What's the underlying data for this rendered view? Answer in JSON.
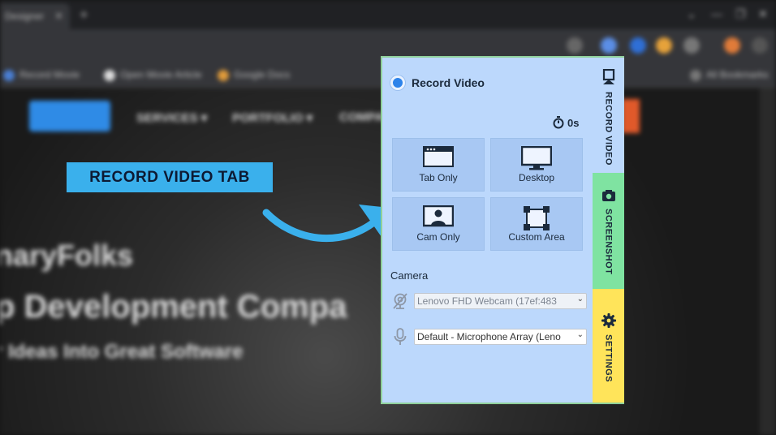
{
  "browser": {
    "tab_title": "Designer",
    "tab_close": "✕",
    "new_tab": "+",
    "window_controls": [
      "⌄",
      "—",
      "❐",
      "✕"
    ],
    "bookmarks": [
      "Record Movie",
      "Open Movie Article",
      "Google Docs",
      "All Bookmarks"
    ]
  },
  "website": {
    "nav": [
      "SERVICES ▾",
      "PORTFOLIO ▾",
      "COMPANY"
    ],
    "hero_brand": "naryFolks",
    "hero_title": "p Development Compa",
    "hero_subtitle": "r Ideas Into Great Software"
  },
  "callout": {
    "label": "RECORD VIDEO TAB",
    "color": "#3ab0ec"
  },
  "panel": {
    "title": "Record Video",
    "timer": "0s",
    "options": [
      {
        "label": "Tab Only",
        "icon": "browser-window-icon"
      },
      {
        "label": "Desktop",
        "icon": "monitor-icon"
      },
      {
        "label": "Cam Only",
        "icon": "user-cam-icon"
      },
      {
        "label": "Custom Area",
        "icon": "crop-area-icon"
      }
    ],
    "camera_label": "Camera",
    "camera_select": "Lenovo FHD Webcam (17ef:483",
    "mic_select": "Default - Microphone Array (Leno",
    "tabs": [
      {
        "label": "RECORD VIDEO",
        "icon": "video-device-icon",
        "color": "#bcd8fc"
      },
      {
        "label": "SCREENSHOT",
        "icon": "camera-icon",
        "color": "#7fe3a1"
      },
      {
        "label": "SETTINGS",
        "icon": "gear-icon",
        "color": "#ffe45a"
      }
    ]
  }
}
